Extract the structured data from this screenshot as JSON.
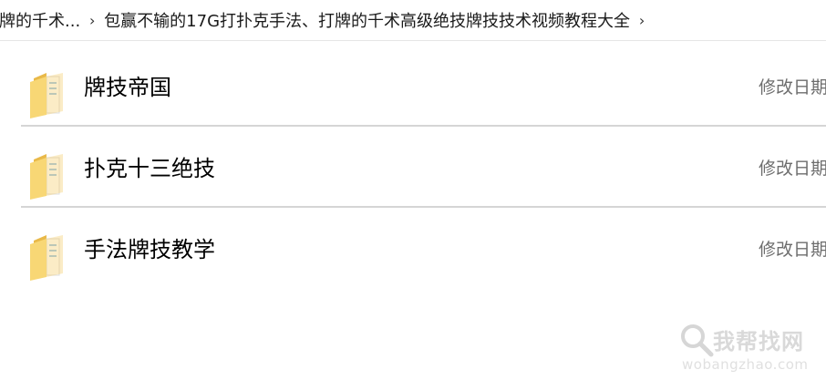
{
  "breadcrumb": {
    "items": [
      {
        "label": "牌的千术..."
      },
      {
        "label": "包赢不输的17G打扑克手法、打牌的千术高级绝技牌技技术视频教程大全"
      }
    ],
    "separator": "›"
  },
  "files": [
    {
      "name": "牌技帝国",
      "meta": "修改日期",
      "icon": "folder-icon"
    },
    {
      "name": "扑克十三绝技",
      "meta": "修改日期",
      "icon": "folder-icon"
    },
    {
      "name": "手法牌技教学",
      "meta": "修改日期",
      "icon": "folder-icon"
    }
  ],
  "watermark": {
    "text": "我帮找网",
    "url": "wobangzhao.com",
    "icon": "magnifier-icon"
  },
  "colors": {
    "folder_body": "#f8d775",
    "folder_back": "#e9b949",
    "divider": "#d5d5d5",
    "meta_text": "#6d6d6d"
  }
}
